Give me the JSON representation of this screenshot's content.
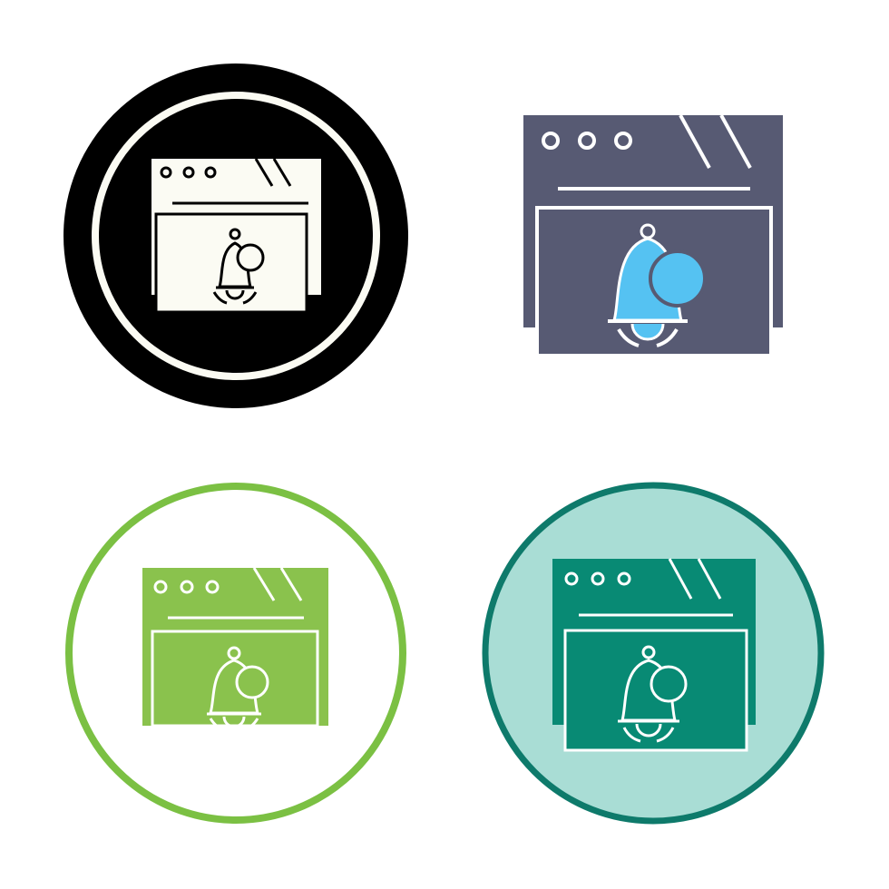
{
  "icons": [
    {
      "icon": "browser-notification-bell",
      "variant": "glyph-circle",
      "colors": {
        "ring_outer": "#000000",
        "ring_inner": "#fbfbf3",
        "window": "#fbfbf3",
        "window_shadow": "#000000",
        "stroke": "#000000"
      }
    },
    {
      "icon": "browser-notification-bell",
      "variant": "flat-color",
      "colors": {
        "window": "#575a73",
        "bell": "#55c2f2",
        "line": "#ffffff"
      }
    },
    {
      "icon": "browser-notification-bell",
      "variant": "outline-circle-green",
      "colors": {
        "ring": "#7bc043",
        "window": "#8ac24d",
        "line": "#ffffff"
      }
    },
    {
      "icon": "browser-notification-bell",
      "variant": "filled-circle-teal",
      "colors": {
        "ring": "#0e7a6b",
        "circle_fill": "#a9ddd5",
        "window": "#088a74",
        "line": "#ffffff"
      }
    }
  ]
}
